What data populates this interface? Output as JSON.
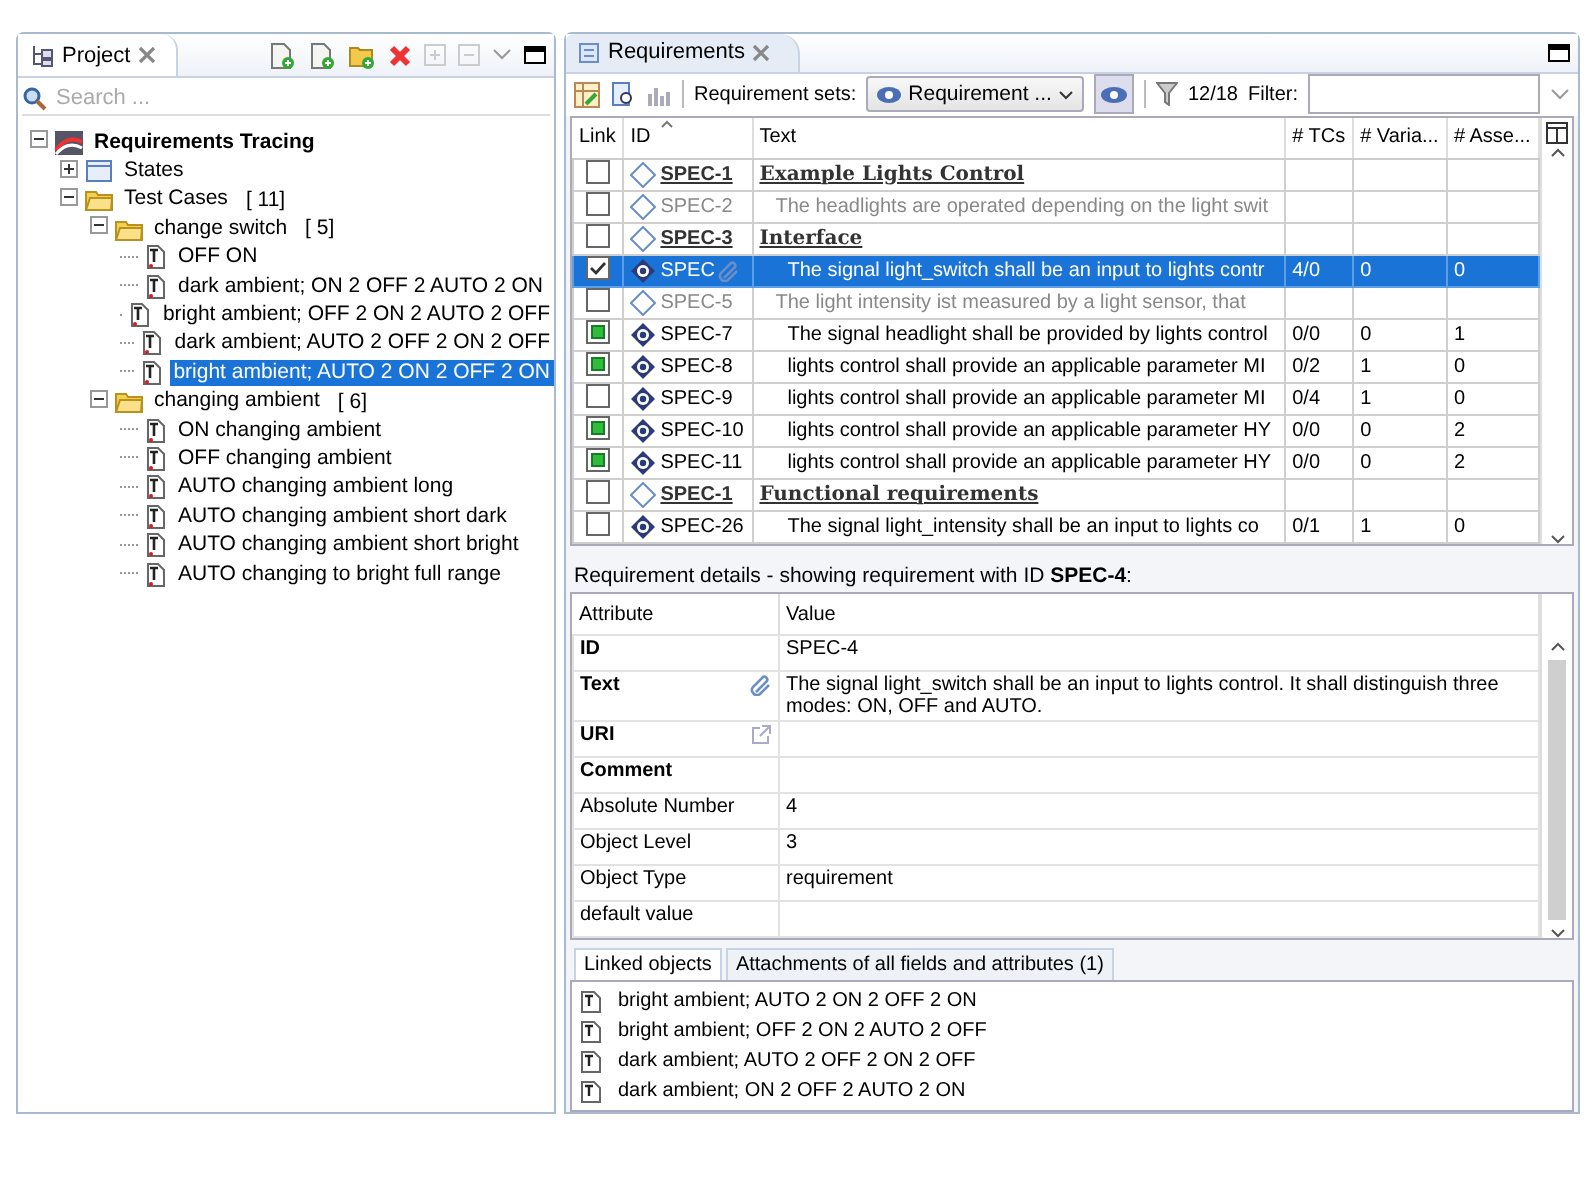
{
  "project": {
    "title": "Project",
    "search_placeholder": "Search ...",
    "tree": [
      {
        "label": "Requirements Tracing",
        "kind": "root",
        "expanded": true,
        "selected": false,
        "children": [
          {
            "label": "States",
            "kind": "states",
            "expanded": false,
            "selected": false
          },
          {
            "label": "Test Cases",
            "count": "[ 11]",
            "kind": "folder",
            "expanded": true,
            "selected": false,
            "children": [
              {
                "label": "change switch",
                "count": "[ 5]",
                "kind": "folder",
                "expanded": true,
                "selected": false,
                "children": [
                  {
                    "label": "OFF ON",
                    "kind": "test",
                    "selected": false
                  },
                  {
                    "label": "dark ambient; ON 2 OFF 2 AUTO 2 ON",
                    "kind": "test",
                    "selected": false
                  },
                  {
                    "label": "bright ambient; OFF 2 ON 2 AUTO 2 OFF",
                    "kind": "test",
                    "selected": false
                  },
                  {
                    "label": "dark ambient; AUTO 2 OFF 2 ON 2 OFF",
                    "kind": "test",
                    "selected": false
                  },
                  {
                    "label": "bright ambient; AUTO 2 ON 2 OFF 2 ON",
                    "kind": "test",
                    "selected": true
                  }
                ]
              },
              {
                "label": "changing ambient",
                "count": "[ 6]",
                "kind": "folder",
                "expanded": true,
                "selected": false,
                "children": [
                  {
                    "label": "ON changing ambient",
                    "kind": "test",
                    "selected": false
                  },
                  {
                    "label": "OFF changing ambient",
                    "kind": "test",
                    "selected": false
                  },
                  {
                    "label": "AUTO changing ambient long",
                    "kind": "test",
                    "selected": false
                  },
                  {
                    "label": "AUTO changing ambient short dark",
                    "kind": "test",
                    "selected": false
                  },
                  {
                    "label": "AUTO changing ambient short bright",
                    "kind": "test",
                    "selected": false
                  },
                  {
                    "label": "AUTO changing to bright full range",
                    "kind": "test",
                    "selected": false
                  }
                ]
              }
            ]
          }
        ]
      }
    ]
  },
  "requirements": {
    "title": "Requirements",
    "toolbar": {
      "sets_label": "Requirement sets:",
      "set": "Requirement ...",
      "count": "12/18",
      "filter_label": "Filter:"
    },
    "columns": [
      "Link",
      "ID",
      "Text",
      "# TCs",
      "# Varia...",
      "# Asse..."
    ],
    "rows": [
      {
        "kind": "heading",
        "checked": false,
        "covered": false,
        "selected": false,
        "id": "SPEC-1",
        "text": "Example Lights Control"
      },
      {
        "kind": "info",
        "checked": false,
        "covered": false,
        "selected": false,
        "id": "SPEC-2",
        "text": "The headlights are operated depending on the light swit"
      },
      {
        "kind": "heading",
        "checked": false,
        "covered": false,
        "selected": false,
        "id": "SPEC-3",
        "text": "Interface"
      },
      {
        "kind": "requirement",
        "checked": true,
        "covered": false,
        "selected": true,
        "attachment": true,
        "id": "SPEC",
        "text": "The signal light_switch shall be an input to lights contr",
        "tcs": "4/0",
        "variants": "0",
        "asserts": "0"
      },
      {
        "kind": "info",
        "checked": false,
        "covered": false,
        "selected": false,
        "id": "SPEC-5",
        "text": "The light intensity ist measured by a light sensor, that"
      },
      {
        "kind": "requirement",
        "checked": false,
        "covered": true,
        "selected": false,
        "id": "SPEC-7",
        "text": "The signal headlight shall be provided by lights control",
        "tcs": "0/0",
        "variants": "0",
        "asserts": "1"
      },
      {
        "kind": "requirement",
        "checked": false,
        "covered": true,
        "selected": false,
        "id": "SPEC-8",
        "text": "lights control shall provide an applicable parameter MI",
        "tcs": "0/2",
        "variants": "1",
        "asserts": "0"
      },
      {
        "kind": "requirement",
        "checked": false,
        "covered": false,
        "selected": false,
        "id": "SPEC-9",
        "text": "lights control shall provide an applicable parameter MI",
        "tcs": "0/4",
        "variants": "1",
        "asserts": "0"
      },
      {
        "kind": "requirement",
        "checked": false,
        "covered": true,
        "selected": false,
        "id": "SPEC-10",
        "text": "lights control shall provide an applicable parameter HY",
        "tcs": "0/0",
        "variants": "0",
        "asserts": "2"
      },
      {
        "kind": "requirement",
        "checked": false,
        "covered": true,
        "selected": false,
        "id": "SPEC-11",
        "text": "lights control shall provide an applicable parameter HY",
        "tcs": "0/0",
        "variants": "0",
        "asserts": "2"
      },
      {
        "kind": "heading",
        "checked": false,
        "covered": false,
        "selected": false,
        "id": "SPEC-1",
        "text": "Functional requirements"
      },
      {
        "kind": "requirement",
        "checked": false,
        "covered": false,
        "selected": false,
        "id": "SPEC-26",
        "text": "The signal light_intensity shall be an input to lights co",
        "tcs": "0/1",
        "variants": "1",
        "asserts": "0"
      }
    ],
    "details": {
      "heading": "Requirement details - showing requirement with ID **SPEC-4**:",
      "columns": [
        "Attribute",
        "Value"
      ],
      "rows": [
        {
          "attribute": "ID",
          "bold": true,
          "value": "SPEC-4"
        },
        {
          "attribute": "Text",
          "bold": true,
          "kind": "attachment",
          "value": "The signal light_switch shall be an input to lights control. It shall distinguish three modes: ON, OFF and AUTO."
        },
        {
          "attribute": "URI",
          "bold": true,
          "kind": "link"
        },
        {
          "attribute": "Comment",
          "bold": true
        },
        {
          "attribute": "Absolute Number",
          "bold": false,
          "value": "4"
        },
        {
          "attribute": "Object Level",
          "bold": false,
          "value": "3"
        },
        {
          "attribute": "Object Type",
          "bold": false,
          "value": "requirement"
        },
        {
          "attribute": "default value",
          "bold": false
        }
      ]
    },
    "bottom_tabs": [
      {
        "label": "Linked objects",
        "selected": true
      },
      {
        "label": "Attachments of all fields and attributes (1)",
        "selected": false
      }
    ],
    "linked_objects": [
      "bright ambient; AUTO 2 ON 2 OFF 2 ON",
      "bright ambient; OFF 2 ON 2 AUTO 2 OFF",
      "dark ambient; AUTO 2 OFF 2 ON 2 OFF",
      "dark ambient; ON 2 OFF 2 AUTO 2 ON"
    ]
  }
}
